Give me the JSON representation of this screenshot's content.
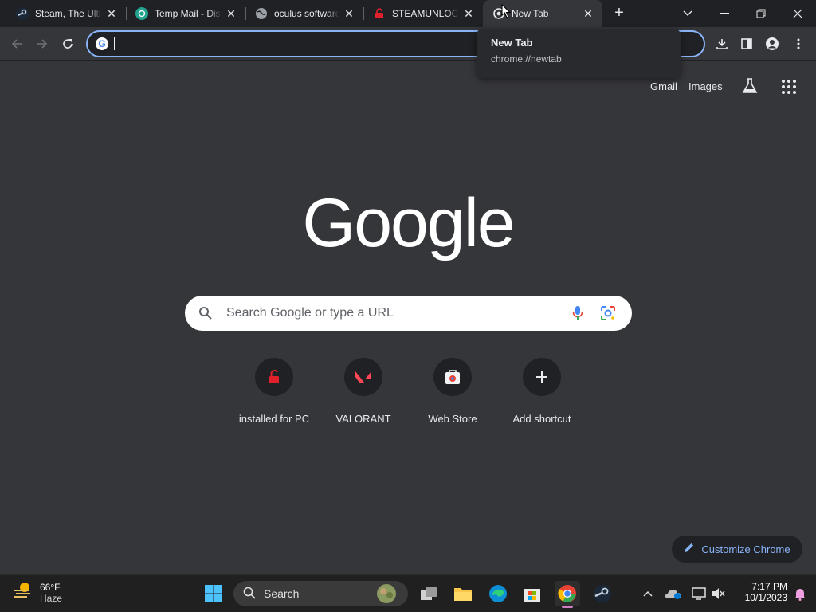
{
  "tabs": [
    {
      "title": "Steam, The Ultimate Online Game Platform",
      "icon": "steam-icon",
      "active": false
    },
    {
      "title": "Temp Mail - Disposable Temporary Email",
      "icon": "tempmail-icon",
      "active": false
    },
    {
      "title": "oculus software",
      "icon": "globe-icon",
      "active": false
    },
    {
      "title": "STEAMUNLOCKED",
      "icon": "steamunlocked-icon",
      "active": false
    },
    {
      "title": "New Tab",
      "icon": "chrome-icon",
      "active": true
    }
  ],
  "hovercard": {
    "title": "New Tab",
    "url": "chrome://newtab"
  },
  "omnibox": {
    "value": "",
    "placeholder": ""
  },
  "top_links": {
    "gmail": "Gmail",
    "images": "Images"
  },
  "logo": "Google",
  "search": {
    "placeholder": "Search Google or type a URL"
  },
  "shortcuts": [
    {
      "label": "installed for PC",
      "icon": "red-unlock-icon"
    },
    {
      "label": "VALORANT",
      "icon": "valorant-icon"
    },
    {
      "label": "Web Store",
      "icon": "webstore-icon"
    },
    {
      "label": "Add shortcut",
      "icon": "plus-icon"
    }
  ],
  "customize": "Customize Chrome",
  "taskbar": {
    "weather_temp": "66°F",
    "weather_desc": "Haze",
    "search_label": "Search",
    "time": "7:17 PM",
    "date": "10/1/2023"
  },
  "colors": {
    "accent": "#8ab4f8",
    "bg": "#35363a",
    "tabstrip": "#202124"
  }
}
